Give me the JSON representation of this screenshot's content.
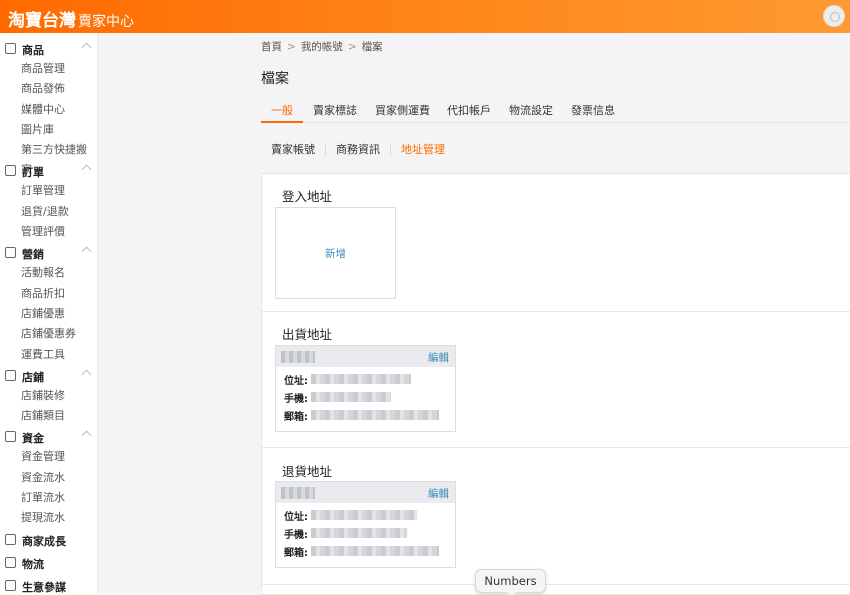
{
  "header": {
    "logo_main": "淘寶台灣",
    "logo_sub": "賣家中心",
    "brand_color": "#ff6a00"
  },
  "sidebar": {
    "groups": [
      {
        "title": "商品",
        "icon": "product-icon",
        "items": [
          "商品管理",
          "商品發佈",
          "媒體中心",
          "圖片庫",
          "第三方快捷搬家"
        ]
      },
      {
        "title": "訂單",
        "icon": "order-icon",
        "items": [
          "訂單管理",
          "退貨/退款",
          "管理評價"
        ]
      },
      {
        "title": "營銷",
        "icon": "megaphone-icon",
        "items": [
          "活動報名",
          "商品折扣",
          "店鋪優惠",
          "店鋪優惠券",
          "運費工具"
        ]
      },
      {
        "title": "店鋪",
        "icon": "store-icon",
        "items": [
          "店鋪裝修",
          "店鋪類目"
        ]
      },
      {
        "title": "資金",
        "icon": "money-icon",
        "items": [
          "資金管理",
          "資金流水",
          "訂單流水",
          "提現流水"
        ]
      },
      {
        "title": "商家成長",
        "icon": "growth-icon",
        "items": []
      },
      {
        "title": "物流",
        "icon": "truck-icon",
        "items": []
      },
      {
        "title": "生意參謀",
        "icon": "chart-icon",
        "items": []
      }
    ]
  },
  "breadcrumb": [
    "首頁",
    "我的帳號",
    "檔案"
  ],
  "page_title": "檔案",
  "tabs": [
    "一般",
    "賣家標誌",
    "買家側運費",
    "代扣帳戶",
    "物流設定",
    "發票信息"
  ],
  "active_tab": "一般",
  "subtabs": [
    "賣家帳號",
    "商務資訊",
    "地址管理"
  ],
  "active_subtab": "地址管理",
  "sections": {
    "login": {
      "title": "登入地址",
      "add_label": "新增"
    },
    "shipping": {
      "title": "出貨地址",
      "edit_label": "編輯",
      "labels": [
        "位址:",
        "手機:",
        "郵箱:"
      ]
    },
    "return": {
      "title": "退貨地址",
      "edit_label": "編輯",
      "labels": [
        "位址:",
        "手機:",
        "郵箱:"
      ]
    }
  },
  "tooltip": "Numbers"
}
